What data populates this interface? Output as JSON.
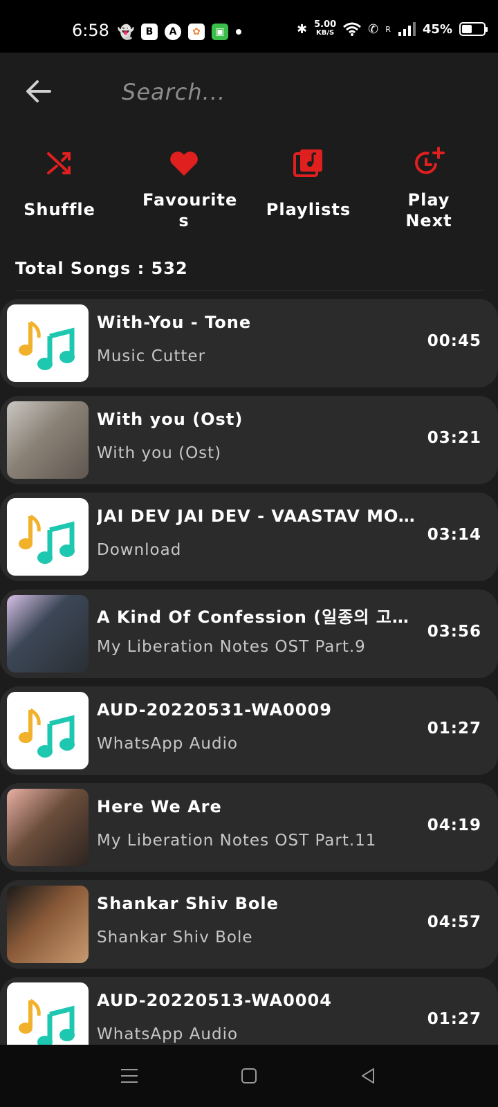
{
  "status": {
    "time": "6:58",
    "speed_value": "5.00",
    "speed_unit": "KB/S",
    "network_label": "R",
    "battery": "45%",
    "battery_level": 0.45
  },
  "search": {
    "placeholder": "Search..."
  },
  "actions": [
    {
      "label": "Shuffle",
      "icon": "shuffle-icon"
    },
    {
      "label": "Favourite s",
      "icon": "heart-icon"
    },
    {
      "label": "Playlists",
      "icon": "playlist-icon"
    },
    {
      "label": "Play Next",
      "icon": "play-next-icon"
    }
  ],
  "total_songs": "Total Songs : 532",
  "colors": {
    "accent": "#e01f1f",
    "background": "#1c1c1c",
    "card": "#2b2b2b"
  },
  "songs": [
    {
      "title": "With-You - Tone",
      "artist": "Music Cutter",
      "duration": "00:45",
      "art": "music-note-icon"
    },
    {
      "title": "With you (Ost)",
      "artist": "With you (Ost)",
      "duration": "03:21",
      "art": "album-art-photo"
    },
    {
      "title": "JAI DEV JAI DEV - VAASTAV MOVIE...",
      "artist": "Download",
      "duration": "03:14",
      "art": "music-note-icon"
    },
    {
      "title": "A Kind Of Confession (일종의 고백) (...",
      "artist": "My Liberation Notes OST Part.9",
      "duration": "03:56",
      "art": "album-art-photo"
    },
    {
      "title": "AUD-20220531-WA0009",
      "artist": "WhatsApp Audio",
      "duration": "01:27",
      "art": "music-note-icon"
    },
    {
      "title": "Here We Are",
      "artist": "My Liberation Notes OST Part.11",
      "duration": "04:19",
      "art": "album-art-photo"
    },
    {
      "title": "Shankar Shiv Bole",
      "artist": "Shankar Shiv Bole",
      "duration": "04:57",
      "art": "album-art-photo"
    },
    {
      "title": "AUD-20220513-WA0004",
      "artist": "WhatsApp Audio",
      "duration": "01:27",
      "art": "music-note-icon"
    }
  ]
}
